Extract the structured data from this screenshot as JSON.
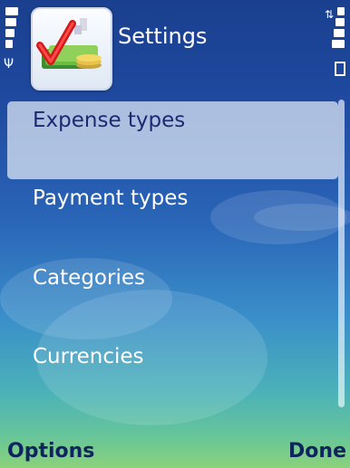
{
  "header": {
    "title": "Settings",
    "app_icon": "expense-app-icon",
    "signal_icon": "signal-strength-icon",
    "antenna_icon": "antenna-icon",
    "battery_icon": "battery-level-icon",
    "data_icon": "packet-data-icon"
  },
  "list": {
    "items": [
      {
        "label": "Expense types",
        "selected": true
      },
      {
        "label": "Payment types"
      },
      {
        "label": "Categories"
      },
      {
        "label": "Currencies"
      }
    ]
  },
  "softkeys": {
    "left": "Options",
    "right": "Done"
  },
  "colors": {
    "selection_text": "#1c2a70",
    "softkey_text": "#0f245e",
    "background_top": "#1a3f8e",
    "background_bottom": "#8bd27a"
  }
}
